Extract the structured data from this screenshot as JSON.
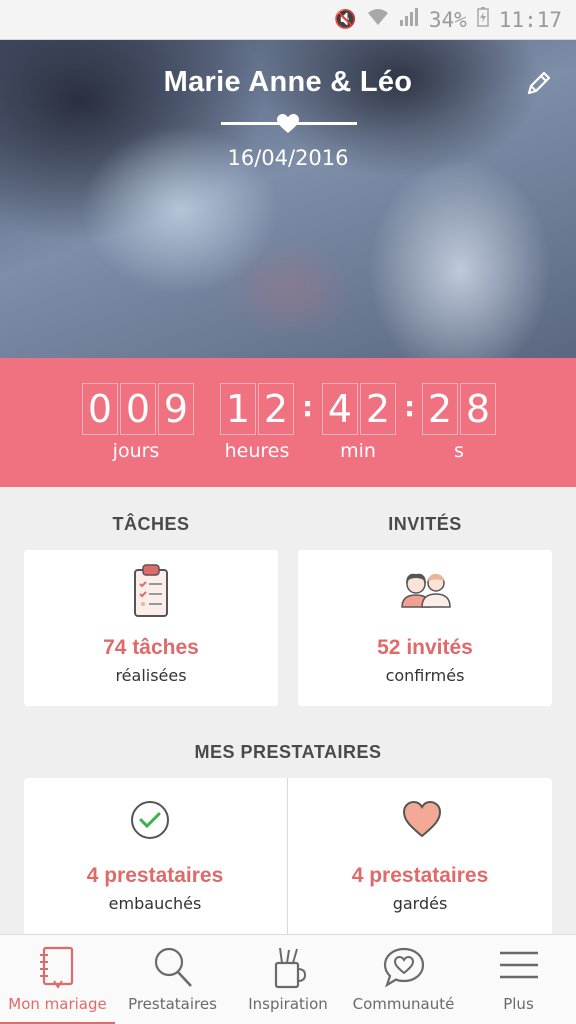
{
  "status_bar": {
    "battery": "34%",
    "time": "11:17"
  },
  "header": {
    "couple_names": "Marie Anne & Léo",
    "wedding_date": "16/04/2016"
  },
  "countdown": {
    "days_digits": [
      "0",
      "0",
      "9"
    ],
    "hours_digits": [
      "1",
      "2"
    ],
    "minutes_digits": [
      "4",
      "2"
    ],
    "seconds_digits": [
      "2",
      "8"
    ],
    "labels": {
      "days": "jours",
      "hours": "heures",
      "minutes": "min",
      "seconds": "s"
    }
  },
  "tasks": {
    "title": "TÂCHES",
    "value": "74 tâches",
    "label": "réalisées"
  },
  "guests": {
    "title": "INVITÉS",
    "value": "52 invités",
    "label": "confirmés"
  },
  "vendors": {
    "title": "MES PRESTATAIRES",
    "hired": {
      "value": "4 prestataires",
      "label": "embauchés"
    },
    "saved": {
      "value": "4 prestataires",
      "label": "gardés"
    }
  },
  "nav": [
    {
      "label": "Mon mariage",
      "icon": "notebook-icon",
      "active": true
    },
    {
      "label": "Prestataires",
      "icon": "search-icon",
      "active": false
    },
    {
      "label": "Inspiration",
      "icon": "pencil-cup-icon",
      "active": false
    },
    {
      "label": "Communauté",
      "icon": "heart-chat-icon",
      "active": false
    },
    {
      "label": "Plus",
      "icon": "menu-icon",
      "active": false
    }
  ],
  "colors": {
    "accent": "#f0717f",
    "accent_text": "#e06a6a",
    "background": "#efefef"
  }
}
